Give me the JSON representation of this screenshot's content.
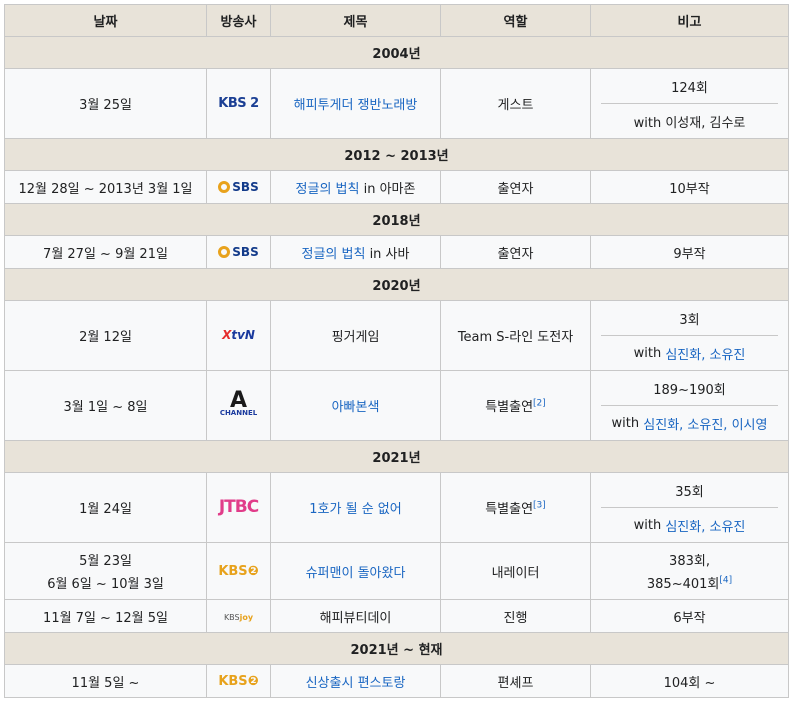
{
  "headers": {
    "date": "날짜",
    "broadcaster": "방송사",
    "title": "제목",
    "role": "역할",
    "note": "비고"
  },
  "years": {
    "y2004": "2004년",
    "y2012": "2012 ~ 2013년",
    "y2018": "2018년",
    "y2020": "2020년",
    "y2021": "2021년",
    "y2021now": "2021년 ~ 현재"
  },
  "logos": {
    "kbs2": "KBS 2",
    "sbs": "SBS",
    "tvn_x": "X",
    "tvn": "tvN",
    "channel_a": "A",
    "channel": "CHANNEL",
    "jtbc": "JTBC",
    "kbs2b": "KBS❷",
    "kbsjoy_a": "KBS",
    "kbsjoy_b": "joy"
  },
  "rows": [
    {
      "date": "3월 25일",
      "title": "해피투게더 쟁반노래방",
      "role": "게스트",
      "note_top": "124회",
      "note_bottom_pre": "with 이성재, 김수로"
    },
    {
      "date": "12월 28일 ~ 2013년 3월 1일",
      "title_link": "정글의 법칙",
      "title_rest": " in 아마존",
      "role": "출연자",
      "note": "10부작"
    },
    {
      "date": "7월 27일 ~ 9월 21일",
      "title_link": "정글의 법칙",
      "title_rest": " in 사바",
      "role": "출연자",
      "note": "9부작"
    },
    {
      "date": "2월 12일",
      "title": "핑거게임",
      "role": "Team S-라인 도전자",
      "note_top": "3회",
      "note_bottom_pre": "with ",
      "note_bottom_link": "심진화, 소유진"
    },
    {
      "date": "3월 1일 ~ 8일",
      "title": "아빠본색",
      "role": "특별출연",
      "role_sup": "[2]",
      "note_top": "189~190회",
      "note_bottom_pre": "with ",
      "note_bottom_link": "심진화, 소유진, 이시영"
    },
    {
      "date": "1월 24일",
      "title": "1호가 될 순 없어",
      "role": "특별출연",
      "role_sup": "[3]",
      "note_top": "35회",
      "note_bottom_pre": "with ",
      "note_bottom_link": "심진화, 소유진"
    },
    {
      "date_1": "5월 23일",
      "date_2": "6월 6일 ~ 10월 3일",
      "title": "슈퍼맨이 돌아왔다",
      "role": "내레이터",
      "note_1": "383회,",
      "note_2": "385~401회",
      "note_sup": "[4]"
    },
    {
      "date": "11월 7일 ~ 12월 5일",
      "title": "해피뷰티데이",
      "role": "진행",
      "note": "6부작"
    },
    {
      "date": "11월 5일 ~",
      "title": "신상출시 편스토랑",
      "role": "편셰프",
      "note": "104회 ~"
    }
  ]
}
